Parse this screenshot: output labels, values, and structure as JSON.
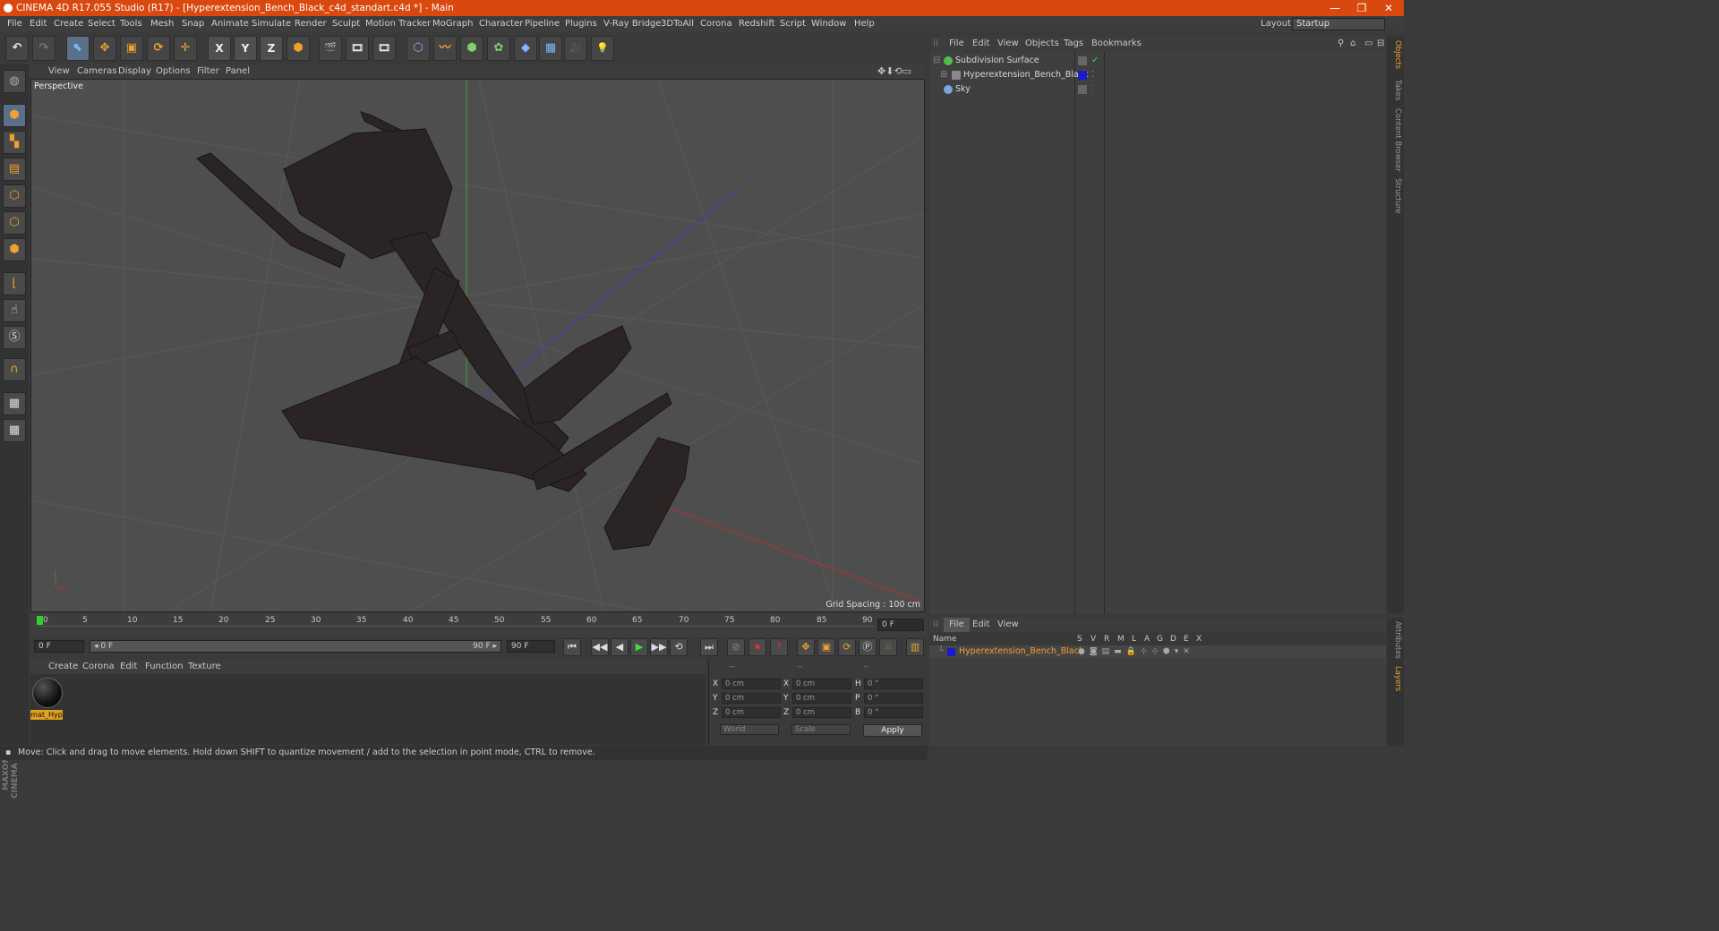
{
  "app": {
    "title": "CINEMA 4D R17.055 Studio (R17) - [Hyperextension_Bench_Black_c4d_standart.c4d *] - Main",
    "window_controls": {
      "minimize": "—",
      "restore": "❐",
      "close": "✕"
    }
  },
  "menubar": {
    "items": [
      "File",
      "Edit",
      "Create",
      "Select",
      "Tools",
      "Mesh",
      "Snap",
      "Animate",
      "Simulate",
      "Render",
      "Sculpt",
      "Motion Tracker",
      "MoGraph",
      "Character",
      "Pipeline",
      "Plugins",
      "V-Ray Bridge",
      "3DToAll",
      "Corona",
      "Redshift",
      "Script",
      "Window",
      "Help"
    ],
    "layout_label": "Layout:",
    "layout_value": "Startup"
  },
  "toolbar": {
    "undo": "↶",
    "redo": "↷",
    "tools": [
      "⬉",
      "✥",
      "▣",
      "⟳",
      "✛"
    ],
    "axes": [
      "X",
      "Y",
      "Z"
    ],
    "extra": [
      "⬢",
      "🎬",
      "🎞",
      "🎞",
      "⬡",
      "〰",
      "⬢",
      "✿",
      "◆",
      "▦",
      "🎥",
      "💡"
    ]
  },
  "viewport_menu": {
    "items": [
      "View",
      "Cameras",
      "Display",
      "Options",
      "Filter",
      "Panel"
    ]
  },
  "viewport": {
    "label": "Perspective",
    "grid_info": "Grid Spacing : 100 cm"
  },
  "timeline": {
    "ticks": [
      "0",
      "5",
      "10",
      "15",
      "20",
      "25",
      "30",
      "35",
      "40",
      "45",
      "50",
      "55",
      "60",
      "65",
      "70",
      "75",
      "80",
      "85",
      "90"
    ],
    "current_frame": "0 F"
  },
  "playbar": {
    "start": "0 F",
    "range_start": "◂ 0 F",
    "range_end": "90 F ▸",
    "end": "90 F",
    "controls": [
      "⏮",
      "◀◀",
      "◀",
      "▶",
      "▶▶",
      "⟲",
      "⏭"
    ]
  },
  "material_menu": {
    "items": [
      "Create",
      "Corona",
      "Edit",
      "Function",
      "Texture"
    ]
  },
  "material": {
    "name": "mat_Hyp"
  },
  "coordinates": {
    "header": [
      "--",
      "--",
      "--"
    ],
    "rows": [
      {
        "a": "X",
        "av": "0 cm",
        "b": "X",
        "bv": "0 cm",
        "c": "H",
        "cv": "0 °"
      },
      {
        "a": "Y",
        "av": "0 cm",
        "b": "Y",
        "bv": "0 cm",
        "c": "P",
        "cv": "0 °"
      },
      {
        "a": "Z",
        "av": "0 cm",
        "b": "Z",
        "bv": "0 cm",
        "c": "B",
        "cv": "0 °"
      }
    ],
    "mode": "World",
    "type": "Scale",
    "apply": "Apply"
  },
  "status": {
    "text": "Move: Click and drag to move elements. Hold down SHIFT to quantize movement / add to the selection in point mode, CTRL to remove."
  },
  "objects_menu": {
    "items": [
      "File",
      "Edit",
      "View",
      "Objects",
      "Tags",
      "Bookmarks"
    ]
  },
  "objects": [
    {
      "name": "Subdivision Surface",
      "color": "#4fc04f"
    },
    {
      "name": "Hyperextension_Bench_Black",
      "color": "#888888"
    },
    {
      "name": "Sky",
      "color": "#7aa8d8"
    }
  ],
  "side_tabs": [
    "Objects",
    "Takes",
    "Content Browser",
    "Structure"
  ],
  "layers_menu": {
    "items": [
      "File",
      "Edit",
      "View"
    ]
  },
  "layers": {
    "header_name": "Name",
    "header_cols": [
      "S",
      "V",
      "R",
      "M",
      "L",
      "A",
      "G",
      "D",
      "E",
      "X"
    ],
    "row_name": "Hyperextension_Bench_Black"
  },
  "side_tabs2": [
    "Attributes",
    "Layers"
  ],
  "maxon": "MAXON CINEMA 4D"
}
